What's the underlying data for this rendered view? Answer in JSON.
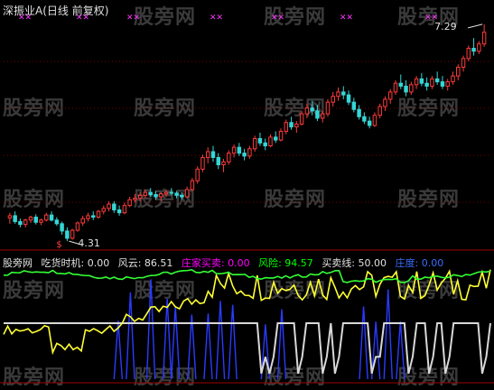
{
  "title": "深振业A(日线 前复权)",
  "watermark": "股旁网",
  "price": {
    "high_label": "7.29",
    "low_label": "4.31",
    "candles": [
      [
        4.63,
        4.7,
        4.55,
        4.66
      ],
      [
        4.66,
        4.72,
        4.55,
        4.58
      ],
      [
        4.58,
        4.62,
        4.5,
        4.54
      ],
      [
        4.54,
        4.62,
        4.5,
        4.6
      ],
      [
        4.6,
        4.66,
        4.56,
        4.64
      ],
      [
        4.64,
        4.68,
        4.54,
        4.57
      ],
      [
        4.57,
        4.62,
        4.53,
        4.6
      ],
      [
        4.6,
        4.7,
        4.58,
        4.67
      ],
      [
        4.67,
        4.72,
        4.58,
        4.6
      ],
      [
        4.6,
        4.64,
        4.52,
        4.55
      ],
      [
        4.55,
        4.58,
        4.4,
        4.45
      ],
      [
        4.45,
        4.5,
        4.31,
        4.35
      ],
      [
        4.35,
        4.48,
        4.33,
        4.46
      ],
      [
        4.46,
        4.58,
        4.44,
        4.56
      ],
      [
        4.56,
        4.66,
        4.52,
        4.62
      ],
      [
        4.62,
        4.7,
        4.58,
        4.66
      ],
      [
        4.66,
        4.72,
        4.6,
        4.64
      ],
      [
        4.64,
        4.74,
        4.62,
        4.72
      ],
      [
        4.72,
        4.8,
        4.68,
        4.76
      ],
      [
        4.76,
        4.86,
        4.72,
        4.82
      ],
      [
        4.82,
        4.86,
        4.7,
        4.74
      ],
      [
        4.74,
        4.8,
        4.66,
        4.7
      ],
      [
        4.7,
        4.84,
        4.68,
        4.8
      ],
      [
        4.8,
        4.92,
        4.78,
        4.88
      ],
      [
        4.88,
        4.96,
        4.84,
        4.9
      ],
      [
        4.9,
        4.98,
        4.86,
        4.94
      ],
      [
        4.94,
        5.02,
        4.9,
        4.98
      ],
      [
        4.98,
        5.04,
        4.92,
        4.95
      ],
      [
        4.95,
        5.0,
        4.88,
        4.92
      ],
      [
        4.92,
        4.98,
        4.86,
        4.96
      ],
      [
        4.96,
        5.02,
        4.92,
        4.98
      ],
      [
        4.98,
        5.04,
        4.94,
        4.97
      ],
      [
        4.97,
        5.0,
        4.9,
        4.94
      ],
      [
        4.94,
        4.98,
        4.88,
        4.92
      ],
      [
        4.92,
        5.06,
        4.9,
        5.02
      ],
      [
        5.02,
        5.18,
        5.0,
        5.14
      ],
      [
        5.14,
        5.34,
        5.1,
        5.3
      ],
      [
        5.3,
        5.5,
        5.26,
        5.46
      ],
      [
        5.46,
        5.6,
        5.38,
        5.54
      ],
      [
        5.54,
        5.62,
        5.4,
        5.46
      ],
      [
        5.46,
        5.52,
        5.3,
        5.36
      ],
      [
        5.36,
        5.44,
        5.26,
        5.4
      ],
      [
        5.4,
        5.56,
        5.36,
        5.52
      ],
      [
        5.52,
        5.64,
        5.46,
        5.6
      ],
      [
        5.6,
        5.66,
        5.48,
        5.52
      ],
      [
        5.52,
        5.58,
        5.42,
        5.48
      ],
      [
        5.48,
        5.62,
        5.44,
        5.58
      ],
      [
        5.58,
        5.76,
        5.54,
        5.72
      ],
      [
        5.72,
        5.8,
        5.62,
        5.66
      ],
      [
        5.66,
        5.72,
        5.56,
        5.62
      ],
      [
        5.62,
        5.78,
        5.6,
        5.74
      ],
      [
        5.74,
        5.82,
        5.66,
        5.7
      ],
      [
        5.7,
        5.86,
        5.68,
        5.82
      ],
      [
        5.82,
        5.98,
        5.78,
        5.94
      ],
      [
        5.94,
        6.02,
        5.84,
        5.88
      ],
      [
        5.88,
        5.96,
        5.8,
        5.92
      ],
      [
        5.92,
        6.1,
        5.9,
        6.06
      ],
      [
        6.06,
        6.2,
        6.0,
        6.14
      ],
      [
        6.14,
        6.24,
        6.04,
        6.1
      ],
      [
        6.1,
        6.18,
        5.96,
        6.0
      ],
      [
        6.0,
        6.1,
        5.94,
        6.06
      ],
      [
        6.06,
        6.26,
        6.02,
        6.22
      ],
      [
        6.22,
        6.36,
        6.16,
        6.3
      ],
      [
        6.3,
        6.42,
        6.24,
        6.36
      ],
      [
        6.36,
        6.44,
        6.26,
        6.32
      ],
      [
        6.32,
        6.38,
        6.18,
        6.22
      ],
      [
        6.22,
        6.28,
        6.08,
        6.12
      ],
      [
        6.12,
        6.18,
        5.98,
        6.02
      ],
      [
        6.02,
        6.08,
        5.92,
        5.96
      ],
      [
        5.96,
        6.02,
        5.86,
        5.9
      ],
      [
        5.9,
        6.08,
        5.88,
        6.04
      ],
      [
        6.04,
        6.2,
        6.0,
        6.16
      ],
      [
        6.16,
        6.3,
        6.1,
        6.26
      ],
      [
        6.26,
        6.4,
        6.2,
        6.36
      ],
      [
        6.36,
        6.52,
        6.32,
        6.48
      ],
      [
        6.48,
        6.6,
        6.4,
        6.44
      ],
      [
        6.44,
        6.52,
        6.3,
        6.36
      ],
      [
        6.36,
        6.5,
        6.32,
        6.46
      ],
      [
        6.46,
        6.58,
        6.4,
        6.54
      ],
      [
        6.54,
        6.62,
        6.44,
        6.48
      ],
      [
        6.48,
        6.56,
        6.38,
        6.44
      ],
      [
        6.44,
        6.58,
        6.4,
        6.54
      ],
      [
        6.54,
        6.64,
        6.46,
        6.5
      ],
      [
        6.5,
        6.58,
        6.4,
        6.44
      ],
      [
        6.44,
        6.54,
        6.38,
        6.5
      ],
      [
        6.5,
        6.64,
        6.46,
        6.58
      ],
      [
        6.58,
        6.74,
        6.52,
        6.7
      ],
      [
        6.7,
        6.86,
        6.64,
        6.82
      ],
      [
        6.82,
        7.0,
        6.78,
        6.96
      ],
      [
        6.96,
        7.1,
        6.86,
        6.92
      ],
      [
        6.92,
        7.06,
        6.88,
        7.02
      ],
      [
        7.02,
        7.29,
        6.98,
        7.18
      ]
    ]
  },
  "indicator": {
    "header": {
      "name": "股旁网",
      "items": [
        {
          "label": "吃货时机: 0.00",
          "color": "#e0e0e0"
        },
        {
          "label": "风云: 86.51",
          "color": "#e0e0e0"
        },
        {
          "label": "庄家买卖: 0.00",
          "color": "#ff00ff"
        },
        {
          "label": "风险: 94.57",
          "color": "#00ff00"
        },
        {
          "label": "买卖线: 50.00",
          "color": "#e0e0e0"
        },
        {
          "label": "庄度: 0.00",
          "color": "#3b6cff"
        }
      ]
    }
  },
  "colors": {
    "up": "#ff3b3b",
    "down": "#35d6d6",
    "grid": "#7a0000",
    "green": "#33ff33",
    "yellow": "#ffff33",
    "white": "#d8d8d8",
    "blue": "#2a3bff",
    "magenta": "#ff33ff"
  }
}
